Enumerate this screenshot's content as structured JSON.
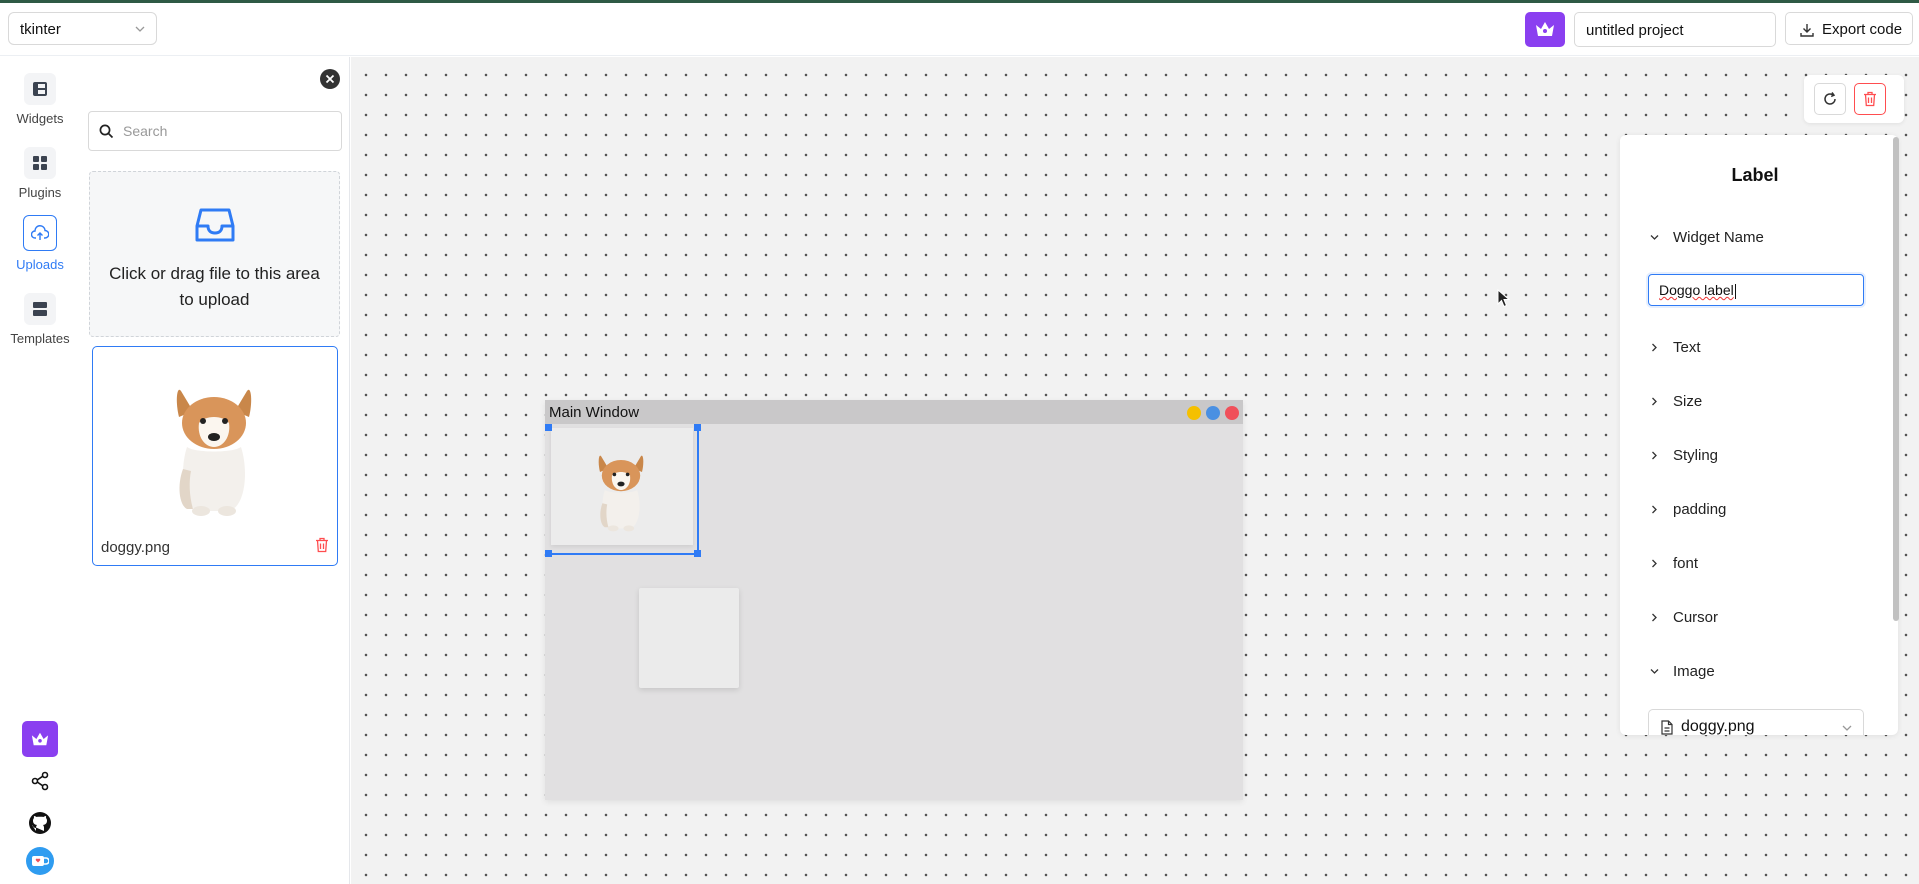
{
  "topbar": {
    "framework": "tkinter",
    "project_name": "untitled project",
    "export_label": "Export code"
  },
  "rail": {
    "items": [
      {
        "label": "Widgets",
        "icon": "widgets-icon",
        "active": false
      },
      {
        "label": "Plugins",
        "icon": "plugins-icon",
        "active": false
      },
      {
        "label": "Uploads",
        "icon": "upload-cloud-icon",
        "active": true
      },
      {
        "label": "Templates",
        "icon": "templates-icon",
        "active": false
      }
    ],
    "bottom_icons": [
      "crown-icon",
      "share-icon",
      "github-icon",
      "support-icon"
    ]
  },
  "panel": {
    "search_placeholder": "Search",
    "upload_text": "Click or drag file to this area to upload",
    "asset": {
      "filename": "doggy.png"
    }
  },
  "canvas": {
    "window_title": "Main Window",
    "window_dots": [
      "#f5c000",
      "#4a90e2",
      "#f0505a"
    ]
  },
  "properties": {
    "title": "Label",
    "sections": {
      "widget_name": "Widget Name",
      "text": "Text",
      "size": "Size",
      "styling": "Styling",
      "padding": "padding",
      "font": "font",
      "cursor": "Cursor",
      "image": "Image"
    },
    "widget_name_value": "Doggo label",
    "image_value": "doggy.png"
  },
  "colors": {
    "accent": "#2f7bf5",
    "brand": "#8a3ff0",
    "danger": "#ff4d4f"
  }
}
